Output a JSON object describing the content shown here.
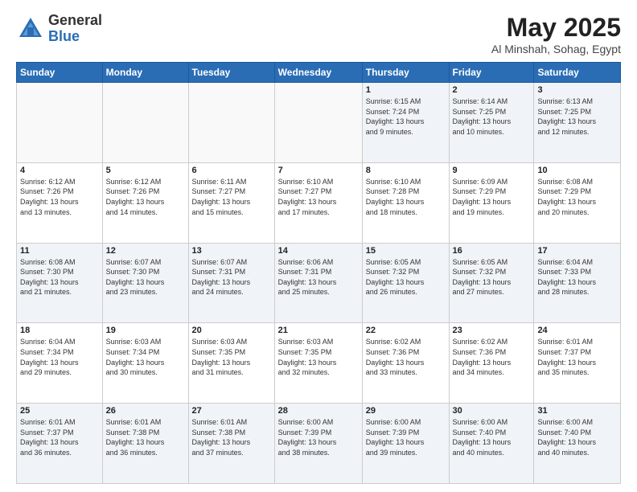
{
  "logo": {
    "general": "General",
    "blue": "Blue"
  },
  "title": "May 2025",
  "subtitle": "Al Minshah, Sohag, Egypt",
  "days_header": [
    "Sunday",
    "Monday",
    "Tuesday",
    "Wednesday",
    "Thursday",
    "Friday",
    "Saturday"
  ],
  "weeks": [
    [
      {
        "num": "",
        "info": ""
      },
      {
        "num": "",
        "info": ""
      },
      {
        "num": "",
        "info": ""
      },
      {
        "num": "",
        "info": ""
      },
      {
        "num": "1",
        "info": "Sunrise: 6:15 AM\nSunset: 7:24 PM\nDaylight: 13 hours\nand 9 minutes."
      },
      {
        "num": "2",
        "info": "Sunrise: 6:14 AM\nSunset: 7:25 PM\nDaylight: 13 hours\nand 10 minutes."
      },
      {
        "num": "3",
        "info": "Sunrise: 6:13 AM\nSunset: 7:25 PM\nDaylight: 13 hours\nand 12 minutes."
      }
    ],
    [
      {
        "num": "4",
        "info": "Sunrise: 6:12 AM\nSunset: 7:26 PM\nDaylight: 13 hours\nand 13 minutes."
      },
      {
        "num": "5",
        "info": "Sunrise: 6:12 AM\nSunset: 7:26 PM\nDaylight: 13 hours\nand 14 minutes."
      },
      {
        "num": "6",
        "info": "Sunrise: 6:11 AM\nSunset: 7:27 PM\nDaylight: 13 hours\nand 15 minutes."
      },
      {
        "num": "7",
        "info": "Sunrise: 6:10 AM\nSunset: 7:27 PM\nDaylight: 13 hours\nand 17 minutes."
      },
      {
        "num": "8",
        "info": "Sunrise: 6:10 AM\nSunset: 7:28 PM\nDaylight: 13 hours\nand 18 minutes."
      },
      {
        "num": "9",
        "info": "Sunrise: 6:09 AM\nSunset: 7:29 PM\nDaylight: 13 hours\nand 19 minutes."
      },
      {
        "num": "10",
        "info": "Sunrise: 6:08 AM\nSunset: 7:29 PM\nDaylight: 13 hours\nand 20 minutes."
      }
    ],
    [
      {
        "num": "11",
        "info": "Sunrise: 6:08 AM\nSunset: 7:30 PM\nDaylight: 13 hours\nand 21 minutes."
      },
      {
        "num": "12",
        "info": "Sunrise: 6:07 AM\nSunset: 7:30 PM\nDaylight: 13 hours\nand 23 minutes."
      },
      {
        "num": "13",
        "info": "Sunrise: 6:07 AM\nSunset: 7:31 PM\nDaylight: 13 hours\nand 24 minutes."
      },
      {
        "num": "14",
        "info": "Sunrise: 6:06 AM\nSunset: 7:31 PM\nDaylight: 13 hours\nand 25 minutes."
      },
      {
        "num": "15",
        "info": "Sunrise: 6:05 AM\nSunset: 7:32 PM\nDaylight: 13 hours\nand 26 minutes."
      },
      {
        "num": "16",
        "info": "Sunrise: 6:05 AM\nSunset: 7:32 PM\nDaylight: 13 hours\nand 27 minutes."
      },
      {
        "num": "17",
        "info": "Sunrise: 6:04 AM\nSunset: 7:33 PM\nDaylight: 13 hours\nand 28 minutes."
      }
    ],
    [
      {
        "num": "18",
        "info": "Sunrise: 6:04 AM\nSunset: 7:34 PM\nDaylight: 13 hours\nand 29 minutes."
      },
      {
        "num": "19",
        "info": "Sunrise: 6:03 AM\nSunset: 7:34 PM\nDaylight: 13 hours\nand 30 minutes."
      },
      {
        "num": "20",
        "info": "Sunrise: 6:03 AM\nSunset: 7:35 PM\nDaylight: 13 hours\nand 31 minutes."
      },
      {
        "num": "21",
        "info": "Sunrise: 6:03 AM\nSunset: 7:35 PM\nDaylight: 13 hours\nand 32 minutes."
      },
      {
        "num": "22",
        "info": "Sunrise: 6:02 AM\nSunset: 7:36 PM\nDaylight: 13 hours\nand 33 minutes."
      },
      {
        "num": "23",
        "info": "Sunrise: 6:02 AM\nSunset: 7:36 PM\nDaylight: 13 hours\nand 34 minutes."
      },
      {
        "num": "24",
        "info": "Sunrise: 6:01 AM\nSunset: 7:37 PM\nDaylight: 13 hours\nand 35 minutes."
      }
    ],
    [
      {
        "num": "25",
        "info": "Sunrise: 6:01 AM\nSunset: 7:37 PM\nDaylight: 13 hours\nand 36 minutes."
      },
      {
        "num": "26",
        "info": "Sunrise: 6:01 AM\nSunset: 7:38 PM\nDaylight: 13 hours\nand 36 minutes."
      },
      {
        "num": "27",
        "info": "Sunrise: 6:01 AM\nSunset: 7:38 PM\nDaylight: 13 hours\nand 37 minutes."
      },
      {
        "num": "28",
        "info": "Sunrise: 6:00 AM\nSunset: 7:39 PM\nDaylight: 13 hours\nand 38 minutes."
      },
      {
        "num": "29",
        "info": "Sunrise: 6:00 AM\nSunset: 7:39 PM\nDaylight: 13 hours\nand 39 minutes."
      },
      {
        "num": "30",
        "info": "Sunrise: 6:00 AM\nSunset: 7:40 PM\nDaylight: 13 hours\nand 40 minutes."
      },
      {
        "num": "31",
        "info": "Sunrise: 6:00 AM\nSunset: 7:40 PM\nDaylight: 13 hours\nand 40 minutes."
      }
    ]
  ]
}
